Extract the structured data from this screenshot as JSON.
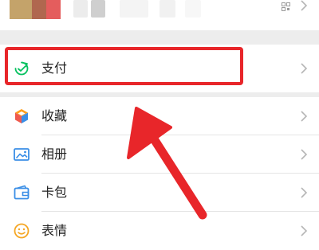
{
  "menu": {
    "items": [
      {
        "label": "支付",
        "icon": "wallet-icon"
      },
      {
        "label": "收藏",
        "icon": "cube-icon"
      },
      {
        "label": "相册",
        "icon": "image-icon"
      },
      {
        "label": "卡包",
        "icon": "card-wallet-icon"
      },
      {
        "label": "表情",
        "icon": "smiley-icon"
      }
    ]
  },
  "colors": {
    "highlight": "#e8262a",
    "arrow": "#e8262a",
    "background": "#ededed",
    "pay_icon": "#07c160",
    "fav_icon_top": "#ff9e1b",
    "fav_icon_left": "#ef5a4e",
    "fav_icon_right": "#3a8ee6",
    "album_icon": "#3a8ee6",
    "card_icon": "#3a8ee6",
    "emoji_icon": "#f5a623"
  }
}
